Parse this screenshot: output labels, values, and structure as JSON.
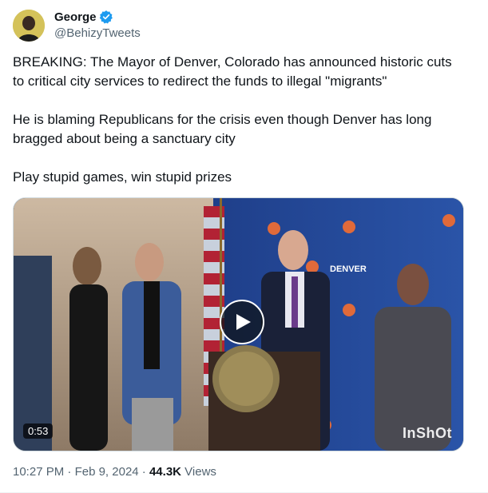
{
  "author": {
    "display_name": "George",
    "handle": "@BehizyTweets",
    "verified_icon": "verified-badge-icon",
    "badge_color": "#1d9bf0"
  },
  "tweet": {
    "paragraphs": [
      "BREAKING: The Mayor of Denver, Colorado has announced historic cuts to critical city services to redirect the funds to illegal \"migrants\"",
      "He is blaming Republicans for the crisis even though Denver has long bragged about being a sanctuary city",
      "Play stupid games, win stupid prizes"
    ]
  },
  "video": {
    "duration": "0:53",
    "watermark": "InShOt",
    "backdrop_text": "DENVER",
    "play_icon": "play-icon"
  },
  "meta": {
    "time": "10:27 PM",
    "separator": "·",
    "date": "Feb 9, 2024",
    "views_count": "44.3K",
    "views_label": "Views"
  }
}
